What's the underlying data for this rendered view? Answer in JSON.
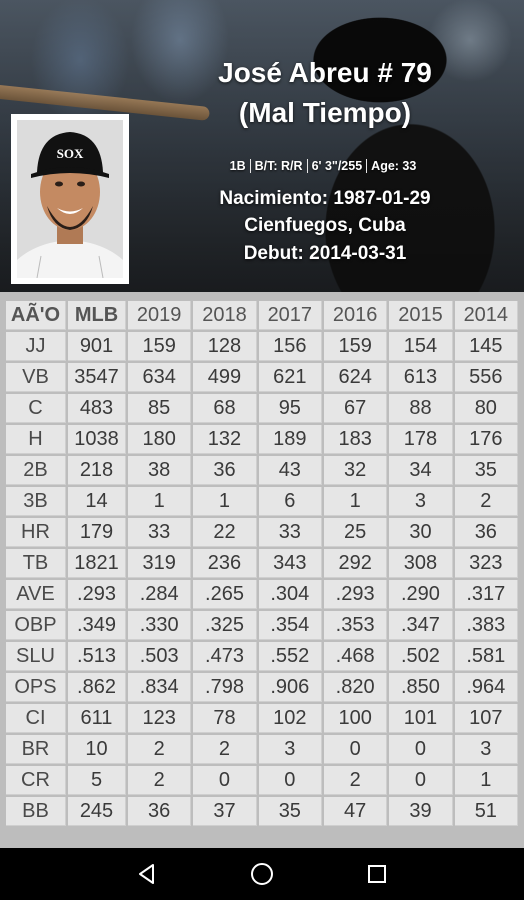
{
  "player": {
    "name_line": "José Abreu # 79",
    "team_line": "(Mal Tiempo)",
    "info": [
      "1B",
      "B/T: R/R",
      "6' 3\"/255",
      "Age: 33"
    ],
    "birth": "Nacimiento: 1987-01-29",
    "birthplace": "Cienfuegos, Cuba",
    "debut": "Debut: 2014-03-31",
    "cap_logo": "SOX"
  },
  "table": {
    "headers": [
      "AÃ'O",
      "MLB",
      "2019",
      "2018",
      "2017",
      "2016",
      "2015",
      "2014"
    ],
    "rows": [
      {
        "label": "JJ",
        "values": [
          "901",
          "159",
          "128",
          "156",
          "159",
          "154",
          "145"
        ]
      },
      {
        "label": "VB",
        "values": [
          "3547",
          "634",
          "499",
          "621",
          "624",
          "613",
          "556"
        ]
      },
      {
        "label": "C",
        "values": [
          "483",
          "85",
          "68",
          "95",
          "67",
          "88",
          "80"
        ]
      },
      {
        "label": "H",
        "values": [
          "1038",
          "180",
          "132",
          "189",
          "183",
          "178",
          "176"
        ]
      },
      {
        "label": "2B",
        "values": [
          "218",
          "38",
          "36",
          "43",
          "32",
          "34",
          "35"
        ]
      },
      {
        "label": "3B",
        "values": [
          "14",
          "1",
          "1",
          "6",
          "1",
          "3",
          "2"
        ]
      },
      {
        "label": "HR",
        "values": [
          "179",
          "33",
          "22",
          "33",
          "25",
          "30",
          "36"
        ]
      },
      {
        "label": "TB",
        "values": [
          "1821",
          "319",
          "236",
          "343",
          "292",
          "308",
          "323"
        ]
      },
      {
        "label": "AVE",
        "values": [
          ".293",
          ".284",
          ".265",
          ".304",
          ".293",
          ".290",
          ".317"
        ]
      },
      {
        "label": "OBP",
        "values": [
          ".349",
          ".330",
          ".325",
          ".354",
          ".353",
          ".347",
          ".383"
        ]
      },
      {
        "label": "SLU",
        "values": [
          ".513",
          ".503",
          ".473",
          ".552",
          ".468",
          ".502",
          ".581"
        ]
      },
      {
        "label": "OPS",
        "values": [
          ".862",
          ".834",
          ".798",
          ".906",
          ".820",
          ".850",
          ".964"
        ]
      },
      {
        "label": "CI",
        "values": [
          "611",
          "123",
          "78",
          "102",
          "100",
          "101",
          "107"
        ]
      },
      {
        "label": "BR",
        "values": [
          "10",
          "2",
          "2",
          "3",
          "0",
          "0",
          "3"
        ]
      },
      {
        "label": "CR",
        "values": [
          "5",
          "2",
          "0",
          "0",
          "2",
          "0",
          "1"
        ]
      },
      {
        "label": "BB",
        "values": [
          "245",
          "36",
          "37",
          "35",
          "47",
          "39",
          "51"
        ]
      }
    ]
  },
  "navbar": {
    "icons": [
      "back-icon",
      "home-icon",
      "recents-icon"
    ],
    "color": "#ffffff"
  },
  "colors": {
    "header_bg": "#3d4650",
    "cell_bg": "#e6e6e6",
    "grid_bg": "#bdbdbd"
  }
}
